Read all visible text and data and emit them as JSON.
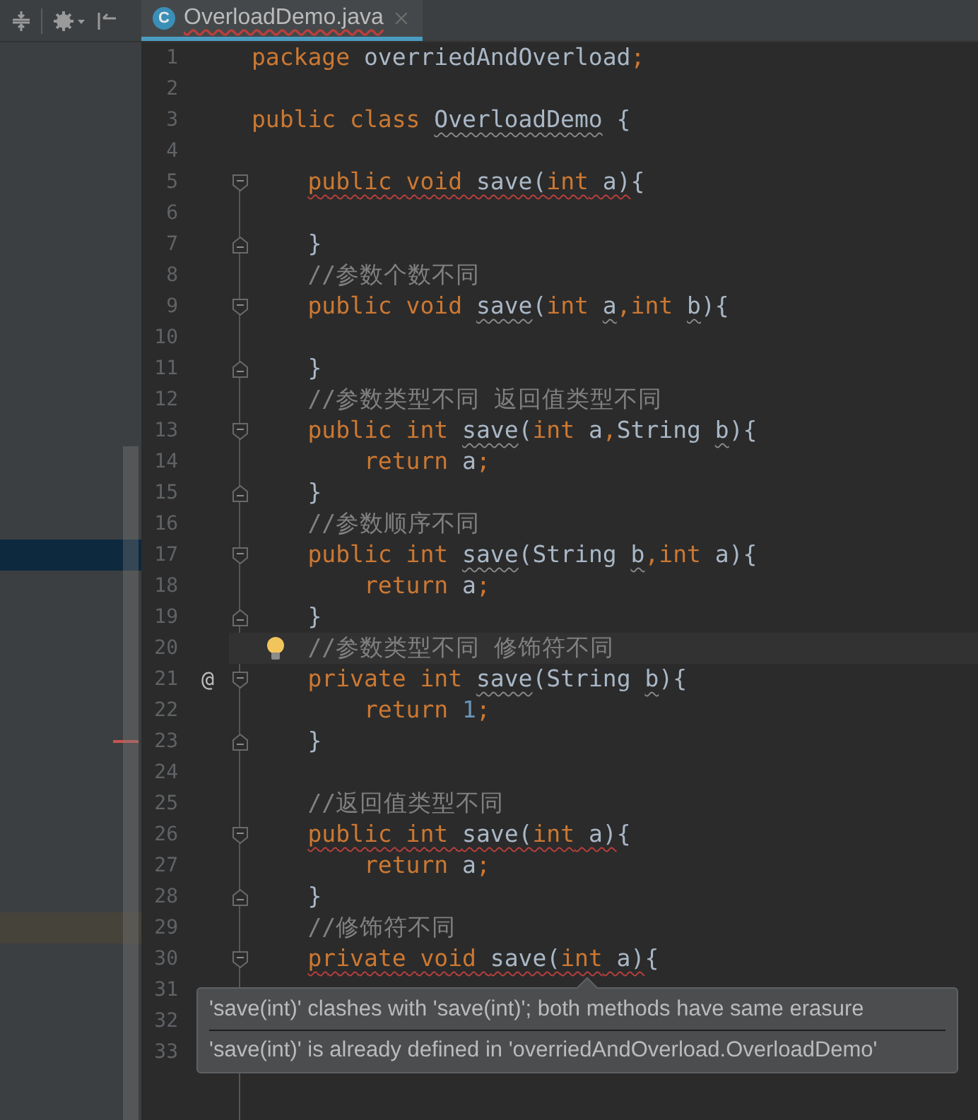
{
  "tab": {
    "icon_letter": "C",
    "title": "OverloadDemo.java",
    "selected": true
  },
  "lines": [
    {
      "number": "1",
      "tokens": [
        {
          "text": "package",
          "kind": "keyword"
        },
        {
          "text": " overriedAndOverload",
          "kind": "text"
        },
        {
          "text": ";",
          "kind": "keyword"
        }
      ]
    },
    {
      "number": "2"
    },
    {
      "number": "3",
      "tokens": [
        {
          "text": "public class ",
          "kind": "keyword"
        },
        {
          "text": "OverloadDemo",
          "kind": "text",
          "warning": true
        },
        {
          "text": " {",
          "kind": "text"
        }
      ]
    },
    {
      "number": "4"
    },
    {
      "number": "5",
      "fold_start": true,
      "tokens": [
        {
          "text": "    public void ",
          "kind": "keyword",
          "error": true
        },
        {
          "text": "save(",
          "kind": "text",
          "error": true
        },
        {
          "text": "int",
          "kind": "keyword",
          "error": true
        },
        {
          "text": " a)",
          "kind": "text",
          "error": true
        },
        {
          "text": "{",
          "kind": "text"
        }
      ]
    },
    {
      "number": "6"
    },
    {
      "number": "7",
      "fold_end": true,
      "tokens": [
        {
          "text": "    }",
          "kind": "text"
        }
      ]
    },
    {
      "number": "8",
      "tokens": [
        {
          "text": "    //参数个数不同",
          "kind": "comment"
        }
      ]
    },
    {
      "number": "9",
      "fold_start": true,
      "tokens": [
        {
          "text": "    public void ",
          "kind": "keyword"
        },
        {
          "text": "save",
          "kind": "text",
          "warning": true
        },
        {
          "text": "(",
          "kind": "text"
        },
        {
          "text": "int ",
          "kind": "keyword"
        },
        {
          "text": "a",
          "kind": "text",
          "warning": true
        },
        {
          "text": ",int ",
          "kind": "keyword"
        },
        {
          "text": "b",
          "kind": "text",
          "warning": true
        },
        {
          "text": "){",
          "kind": "text"
        }
      ]
    },
    {
      "number": "10"
    },
    {
      "number": "11",
      "fold_end": true,
      "tokens": [
        {
          "text": "    }",
          "kind": "text"
        }
      ]
    },
    {
      "number": "12",
      "tokens": [
        {
          "text": "    //参数类型不同 返回值类型不同",
          "kind": "comment"
        }
      ]
    },
    {
      "number": "13",
      "fold_start": true,
      "tokens": [
        {
          "text": "    public int ",
          "kind": "keyword"
        },
        {
          "text": "save",
          "kind": "text",
          "warning": true
        },
        {
          "text": "(",
          "kind": "text"
        },
        {
          "text": "int ",
          "kind": "keyword"
        },
        {
          "text": "a",
          "kind": "text"
        },
        {
          "text": ",",
          "kind": "keyword"
        },
        {
          "text": "String ",
          "kind": "text"
        },
        {
          "text": "b",
          "kind": "text",
          "warning": true
        },
        {
          "text": "){",
          "kind": "text"
        }
      ]
    },
    {
      "number": "14",
      "tokens": [
        {
          "text": "        return ",
          "kind": "keyword"
        },
        {
          "text": "a",
          "kind": "text"
        },
        {
          "text": ";",
          "kind": "keyword"
        }
      ]
    },
    {
      "number": "15",
      "fold_end": true,
      "tokens": [
        {
          "text": "    }",
          "kind": "text"
        }
      ]
    },
    {
      "number": "16",
      "tokens": [
        {
          "text": "    //参数顺序不同",
          "kind": "comment"
        }
      ]
    },
    {
      "number": "17",
      "fold_start": true,
      "panel_selected": true,
      "tokens": [
        {
          "text": "    public int ",
          "kind": "keyword"
        },
        {
          "text": "save",
          "kind": "text",
          "warning": true
        },
        {
          "text": "(String ",
          "kind": "text"
        },
        {
          "text": "b",
          "kind": "text",
          "warning": true
        },
        {
          "text": ",int ",
          "kind": "keyword"
        },
        {
          "text": "a){",
          "kind": "text"
        }
      ]
    },
    {
      "number": "18",
      "tokens": [
        {
          "text": "        return ",
          "kind": "keyword"
        },
        {
          "text": "a",
          "kind": "text"
        },
        {
          "text": ";",
          "kind": "keyword"
        }
      ]
    },
    {
      "number": "19",
      "fold_end": true,
      "tokens": [
        {
          "text": "    }",
          "kind": "text"
        }
      ]
    },
    {
      "number": "20",
      "current": true,
      "bulb": true,
      "tokens": [
        {
          "text": "    //参数类型不同 修饰符不同",
          "kind": "comment"
        }
      ]
    },
    {
      "number": "21",
      "marker": "@",
      "fold_start": true,
      "tokens": [
        {
          "text": "    private int ",
          "kind": "keyword"
        },
        {
          "text": "save",
          "kind": "text",
          "warning": true
        },
        {
          "text": "(String ",
          "kind": "text"
        },
        {
          "text": "b",
          "kind": "text",
          "warning": true
        },
        {
          "text": "){",
          "kind": "text"
        }
      ]
    },
    {
      "number": "22",
      "tokens": [
        {
          "text": "        return ",
          "kind": "keyword"
        },
        {
          "text": "1",
          "kind": "number"
        },
        {
          "text": ";",
          "kind": "keyword"
        }
      ]
    },
    {
      "number": "23",
      "fold_end": true,
      "panel_error": true,
      "tokens": [
        {
          "text": "    }",
          "kind": "text"
        }
      ]
    },
    {
      "number": "24"
    },
    {
      "number": "25",
      "tokens": [
        {
          "text": "    //返回值类型不同",
          "kind": "comment"
        }
      ]
    },
    {
      "number": "26",
      "fold_start": true,
      "tokens": [
        {
          "text": "    public int ",
          "kind": "keyword",
          "error": true
        },
        {
          "text": "save(",
          "kind": "text",
          "error": true
        },
        {
          "text": "int",
          "kind": "keyword",
          "error": true
        },
        {
          "text": " a)",
          "kind": "text",
          "error": true
        },
        {
          "text": "{",
          "kind": "text"
        }
      ]
    },
    {
      "number": "27",
      "tokens": [
        {
          "text": "        return ",
          "kind": "keyword"
        },
        {
          "text": "a",
          "kind": "text"
        },
        {
          "text": ";",
          "kind": "keyword"
        }
      ]
    },
    {
      "number": "28",
      "fold_end": true,
      "tokens": [
        {
          "text": "    }",
          "kind": "text"
        }
      ]
    },
    {
      "number": "29",
      "panel_highlighted": true,
      "tokens": [
        {
          "text": "    //修饰符不同",
          "kind": "comment"
        }
      ]
    },
    {
      "number": "30",
      "fold_start": true,
      "tokens": [
        {
          "text": "    private void ",
          "kind": "keyword",
          "error": true
        },
        {
          "text": "save(",
          "kind": "text",
          "error": true
        },
        {
          "text": "int",
          "kind": "keyword",
          "error": true
        },
        {
          "text": " a)",
          "kind": "text",
          "error": true
        },
        {
          "text": "{",
          "kind": "text"
        }
      ]
    },
    {
      "number": "31"
    },
    {
      "number": "32"
    },
    {
      "number": "33"
    }
  ],
  "tooltip": {
    "messages": [
      "'save(int)' clashes with 'save(int)'; both methods have same erasure",
      "'save(int)' is already defined in 'overriedAndOverload.OverloadDemo'"
    ]
  }
}
